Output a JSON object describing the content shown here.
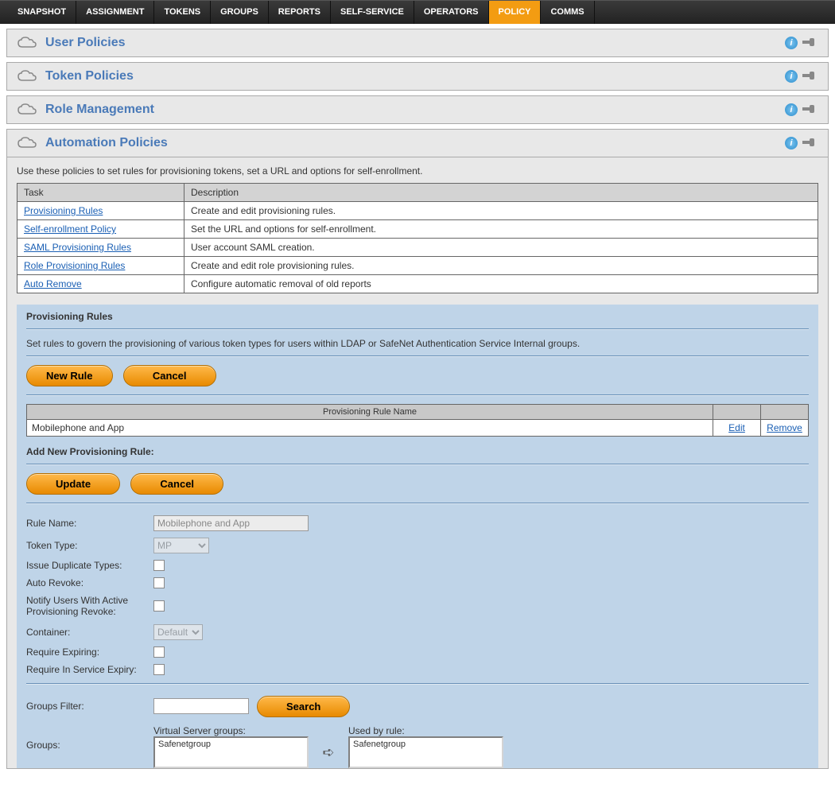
{
  "nav": [
    {
      "label": "SNAPSHOT",
      "active": false
    },
    {
      "label": "ASSIGNMENT",
      "active": false
    },
    {
      "label": "TOKENS",
      "active": false
    },
    {
      "label": "GROUPS",
      "active": false
    },
    {
      "label": "REPORTS",
      "active": false
    },
    {
      "label": "SELF-SERVICE",
      "active": false
    },
    {
      "label": "OPERATORS",
      "active": false
    },
    {
      "label": "POLICY",
      "active": true
    },
    {
      "label": "COMMS",
      "active": false
    }
  ],
  "panels": {
    "user": {
      "title": "User Policies"
    },
    "token": {
      "title": "Token Policies"
    },
    "role": {
      "title": "Role Management"
    },
    "automation": {
      "title": "Automation Policies",
      "description": "Use these policies to set rules for provisioning tokens, set a URL and options for self-enrollment."
    }
  },
  "task_table": {
    "headers": {
      "task": "Task",
      "description": "Description"
    },
    "rows": [
      {
        "task": "Provisioning Rules",
        "description": "Create and edit provisioning rules."
      },
      {
        "task": "Self-enrollment Policy",
        "description": "Set the URL and options for self-enrollment."
      },
      {
        "task": "SAML Provisioning Rules",
        "description": "User account SAML creation."
      },
      {
        "task": "Role Provisioning Rules",
        "description": "Create and edit role provisioning rules."
      },
      {
        "task": "Auto Remove",
        "description": "Configure automatic removal of old reports"
      }
    ]
  },
  "prov_rules": {
    "heading": "Provisioning Rules",
    "subtext": "Set rules to govern the provisioning of various token types for users within LDAP or SafeNet Authentication Service Internal groups.",
    "new_rule_btn": "New Rule",
    "cancel_btn": "Cancel",
    "table_header": "Provisioning Rule Name",
    "rule_name": "Mobilephone and App",
    "edit_link": "Edit",
    "remove_link": "Remove"
  },
  "add_rule": {
    "heading": "Add New Provisioning Rule:",
    "update_btn": "Update",
    "cancel_btn": "Cancel",
    "labels": {
      "rule_name": "Rule Name:",
      "token_type": "Token Type:",
      "issue_dup": "Issue Duplicate Types:",
      "auto_revoke": "Auto Revoke:",
      "notify": "Notify Users With Active Provisioning Revoke:",
      "container": "Container:",
      "require_expiring": "Require Expiring:",
      "require_in_service": "Require In Service Expiry:",
      "groups_filter": "Groups Filter:",
      "groups": "Groups:",
      "virtual_server_groups": "Virtual Server groups:",
      "used_by_rule": "Used by rule:"
    },
    "values": {
      "rule_name": "Mobilephone and App",
      "token_type": "MP",
      "container": "Default",
      "virtual_server_group_item": "Safenetgroup",
      "used_by_rule_item": "Safenetgroup"
    },
    "search_btn": "Search"
  }
}
